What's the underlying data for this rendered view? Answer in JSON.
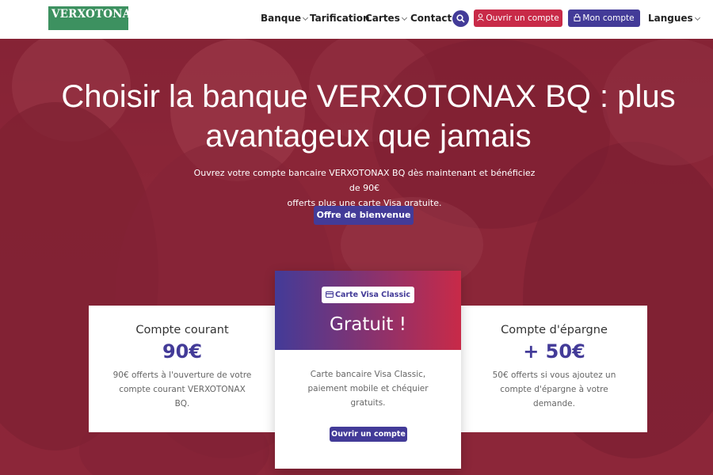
{
  "header": {
    "logo": "VERXOTONAX",
    "nav": [
      {
        "label": "Banque",
        "dropdown": true
      },
      {
        "label": "Tarification",
        "dropdown": false
      },
      {
        "label": "Cartes",
        "dropdown": true
      },
      {
        "label": "Contact",
        "dropdown": false
      }
    ],
    "open_account": "Ouvrir un compte",
    "my_account": "Mon compte",
    "languages": "Langues"
  },
  "hero": {
    "title_line1": "Choisir la banque VERXOTONAX BQ : plus",
    "title_line2": "avantageux que jamais",
    "subtitle_line1": "Ouvrez votre compte bancaire VERXOTONAX BQ dès maintenant et bénéficiez de 90€",
    "subtitle_line2": "offerts plus une carte Visa gratuite.",
    "cta": "Offre de bienvenue"
  },
  "offers": {
    "current": {
      "title": "Compte courant",
      "value": "90€",
      "text": "90€ offerts à l'ouverture de votre compte courant VERXOTONAX BQ."
    },
    "card": {
      "badge": "Carte Visa Classic",
      "title": "Gratuit !",
      "text": "Carte bancaire Visa Classic, paiement mobile et chéquier gratuits.",
      "button": "Ouvrir un compte"
    },
    "savings": {
      "title": "Compte d'épargne",
      "value": "+ 50€",
      "text": "50€ offerts si vous ajoutez un compte d'épargne à votre demande."
    }
  },
  "colors": {
    "brand_green": "#3d9160",
    "primary": "#433b98",
    "accent": "#c82a48",
    "hero_overlay": "#8c2238"
  },
  "icons": [
    "search-icon",
    "user-icon",
    "lock-icon",
    "chevron-down-icon",
    "credit-card-icon"
  ]
}
